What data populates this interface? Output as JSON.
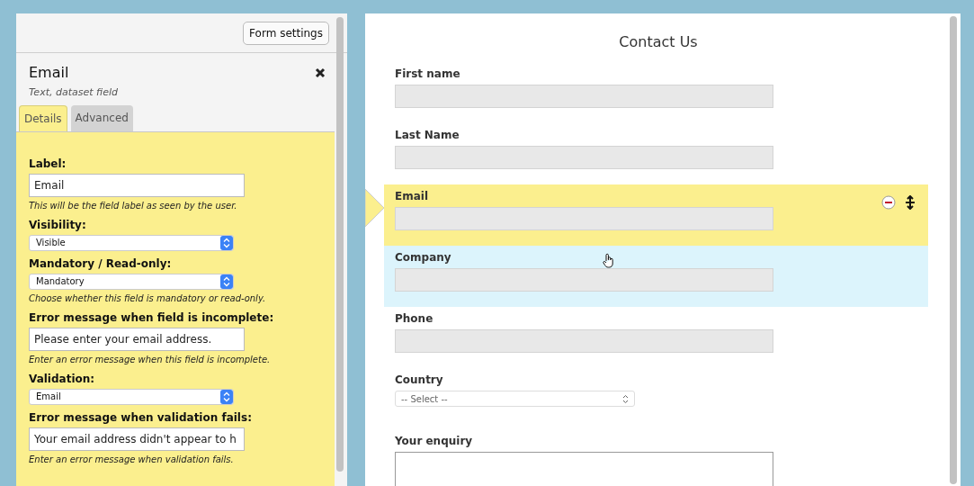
{
  "settings_panel": {
    "form_settings_button": "Form settings",
    "field_title": "Email",
    "field_type": "Text, dataset field",
    "tabs": [
      {
        "label": "Details",
        "selected": true
      },
      {
        "label": "Advanced",
        "selected": false
      }
    ],
    "properties": [
      {
        "kind": "text",
        "label": "Label:",
        "value": "Email",
        "hint": "This will be the field label as seen by the user."
      },
      {
        "kind": "select",
        "label": "Visibility:",
        "value": "Visible"
      },
      {
        "kind": "select",
        "label": "Mandatory / Read-only:",
        "value": "Mandatory",
        "hint": "Choose whether this field is mandatory or read-only."
      },
      {
        "kind": "text",
        "label": "Error message when field is incomplete:",
        "value": "Please enter your email address.",
        "hint": "Enter an error message when this field is incomplete."
      },
      {
        "kind": "select",
        "label": "Validation:",
        "value": "Email"
      },
      {
        "kind": "text",
        "label": "Error message when validation fails:",
        "value": "Your email address didn't appear to h",
        "hint": "Enter an error message when validation fails."
      }
    ]
  },
  "form_preview": {
    "title": "Contact Us",
    "fields": [
      {
        "kind": "text",
        "label": "First name",
        "selected": false,
        "hovered": false
      },
      {
        "kind": "text",
        "label": "Last Name",
        "selected": false,
        "hovered": false
      },
      {
        "kind": "text",
        "label": "Email",
        "selected": true,
        "hovered": false
      },
      {
        "kind": "text",
        "label": "Company",
        "selected": false,
        "hovered": true
      },
      {
        "kind": "text",
        "label": "Phone",
        "selected": false,
        "hovered": false
      },
      {
        "kind": "select",
        "label": "Country",
        "placeholder": "-- Select --",
        "selected": false,
        "hovered": false
      },
      {
        "kind": "textarea",
        "label": "Your enquiry",
        "selected": false,
        "hovered": false
      }
    ]
  }
}
